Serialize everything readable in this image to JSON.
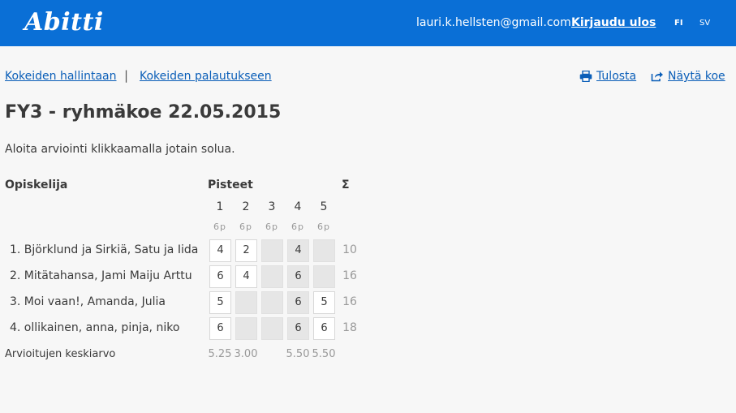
{
  "header": {
    "logo": "Abitti",
    "email": "lauri.k.hellsten@gmail.com",
    "logout_label": "Kirjaudu ulos",
    "lang_fi": "FI",
    "lang_sv": "SV"
  },
  "nav": {
    "exam_management": "Kokeiden hallintaan",
    "separator": "|",
    "exam_returns": "Kokeiden palautukseen",
    "print_label": "Tulosta",
    "show_exam_label": "Näytä koe",
    "print_icon": "print-icon",
    "show_exam_icon": "share-icon"
  },
  "page": {
    "title": "FY3 - ryhmäkoe 22.05.2015",
    "instruction": "Aloita arviointi klikkaamalla jotain solua."
  },
  "table": {
    "student_header": "Opiskelija",
    "points_header": "Pisteet",
    "sum_header": "Σ",
    "questions": [
      {
        "number": "1",
        "max": "6p"
      },
      {
        "number": "2",
        "max": "6p"
      },
      {
        "number": "3",
        "max": "6p"
      },
      {
        "number": "4",
        "max": "6p"
      },
      {
        "number": "5",
        "max": "6p"
      }
    ],
    "rows": [
      {
        "name": "1.  Björklund ja Sirkiä, Satu ja Iida",
        "scores": [
          "4",
          "2",
          "",
          "4",
          ""
        ],
        "total": "10"
      },
      {
        "name": "2.  Mitätahansa, Jami Maiju Arttu",
        "scores": [
          "6",
          "4",
          "",
          "6",
          ""
        ],
        "total": "16"
      },
      {
        "name": "3.  Moi vaan!, Amanda, Julia",
        "scores": [
          "5",
          "",
          "",
          "6",
          "5"
        ],
        "total": "16"
      },
      {
        "name": "4.  ollikainen, anna, pinja, niko",
        "scores": [
          "6",
          "",
          "",
          "6",
          "6"
        ],
        "total": "18"
      }
    ],
    "average_label": "Arvioitujen keskiarvo",
    "averages": [
      "5.25",
      "3.00",
      "",
      "5.50",
      "5.50"
    ]
  },
  "colors": {
    "header_bg": "#0a6fd6",
    "link": "#0a5eb8",
    "shaded_cell": "#e6e6e6"
  }
}
